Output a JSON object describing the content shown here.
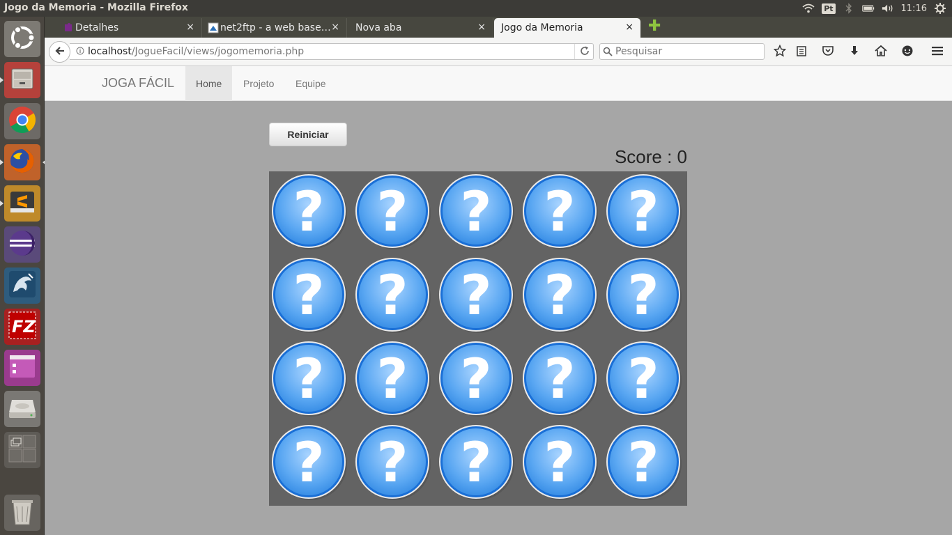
{
  "window": {
    "title": "Jogo da Memoria - Mozilla Firefox"
  },
  "tray": {
    "keyboard_layout": "Pt",
    "clock": "11:16"
  },
  "launcher": {
    "items": [
      {
        "name": "ubuntu-dash",
        "icon": "ubuntu-logo-icon"
      },
      {
        "name": "files",
        "icon": "file-cabinet-icon"
      },
      {
        "name": "chrome",
        "icon": "chrome-icon"
      },
      {
        "name": "firefox",
        "icon": "firefox-icon"
      },
      {
        "name": "sublime-text",
        "icon": "sublime-icon"
      },
      {
        "name": "eclipse",
        "icon": "eclipse-icon"
      },
      {
        "name": "mysql-workbench",
        "icon": "dolphin-icon"
      },
      {
        "name": "filezilla",
        "icon": "filezilla-icon"
      },
      {
        "name": "window-app",
        "icon": "window-icon"
      },
      {
        "name": "disk",
        "icon": "drive-icon"
      },
      {
        "name": "workspaces",
        "icon": "workspace-icon"
      },
      {
        "name": "trash",
        "icon": "trash-icon"
      }
    ]
  },
  "tabs": [
    {
      "label": "Detalhes",
      "active": false
    },
    {
      "label": "net2ftp - a web base…",
      "active": false
    },
    {
      "label": "Nova aba",
      "active": false
    },
    {
      "label": "Jogo da Memoria",
      "active": true
    }
  ],
  "tab_close_glyph": "×",
  "new_tab_glyph": "✚",
  "url": {
    "host": "localhost",
    "path": "/JogueFacil/views/jogomemoria.php"
  },
  "search": {
    "placeholder": "Pesquisar"
  },
  "site": {
    "brand": "JOGA FÁCIL",
    "nav": [
      {
        "label": "Home",
        "active": true
      },
      {
        "label": "Projeto",
        "active": false
      },
      {
        "label": "Equipe",
        "active": false
      }
    ]
  },
  "game": {
    "reset_label": "Reiniciar",
    "score_label": "Score : 0",
    "rows": 4,
    "cols": 5,
    "card_glyph": "?"
  },
  "colors": {
    "panel": "#3c3b37",
    "launcher": "#4a4640",
    "page_bg": "#a6a6a6",
    "board_bg": "#636363",
    "card_blue": "#5aa7f2",
    "card_border": "#1a6fd6"
  }
}
